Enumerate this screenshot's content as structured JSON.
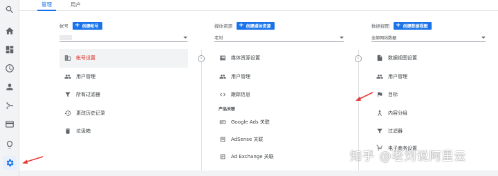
{
  "rail": {
    "icons": [
      "search-icon",
      "home-icon",
      "dashboard-icon",
      "clock-icon",
      "person-icon",
      "branch-icon",
      "card-icon",
      "lightbulb-icon",
      "gear-icon"
    ]
  },
  "tabs": [
    {
      "label": "管理",
      "active": true
    },
    {
      "label": "用户",
      "active": false
    }
  ],
  "account": {
    "heading": "帐号",
    "create_label": "创建帐号",
    "select_value": "",
    "items": [
      {
        "label": "帐号设置",
        "icon": "building-icon"
      },
      {
        "label": "用户管理",
        "icon": "people-icon"
      },
      {
        "label": "所有过滤器",
        "icon": "filter-icon"
      },
      {
        "label": "更改历史记录",
        "icon": "history-icon"
      },
      {
        "label": "垃圾箱",
        "icon": "trash-icon"
      }
    ]
  },
  "property": {
    "heading": "媒体资源",
    "create_label": "创建媒体资源",
    "select_value": "老刘",
    "items": [
      {
        "label": "媒体资源设置",
        "icon": "settings-list-icon"
      },
      {
        "label": "用户管理",
        "icon": "people-icon"
      },
      {
        "label": "跟踪信息",
        "icon": "code-icon"
      }
    ],
    "section_label": "产品关联",
    "linked": [
      {
        "label": "Google Ads 关联",
        "icon": "ads-icon"
      },
      {
        "label": "AdSense 关联",
        "icon": "adsense-icon"
      },
      {
        "label": "Ad Exchange 关联",
        "icon": "adexchange-icon"
      }
    ]
  },
  "view": {
    "heading": "数据视图",
    "create_label": "创建数据视图",
    "select_value": "全部网站数据",
    "items": [
      {
        "label": "数据视图设置",
        "icon": "doc-icon"
      },
      {
        "label": "用户管理",
        "icon": "people-icon"
      },
      {
        "label": "目标",
        "icon": "flag-icon"
      },
      {
        "label": "内容分组",
        "icon": "group-icon"
      },
      {
        "label": "过滤器",
        "icon": "filter-icon"
      },
      {
        "label": "电子商务设置",
        "icon": "cart-icon"
      }
    ]
  },
  "watermark": "知乎 @老刘说阿里云",
  "colors": {
    "accent": "#1a73e8",
    "arrow": "#e53935",
    "selected_text": "#d93025"
  }
}
